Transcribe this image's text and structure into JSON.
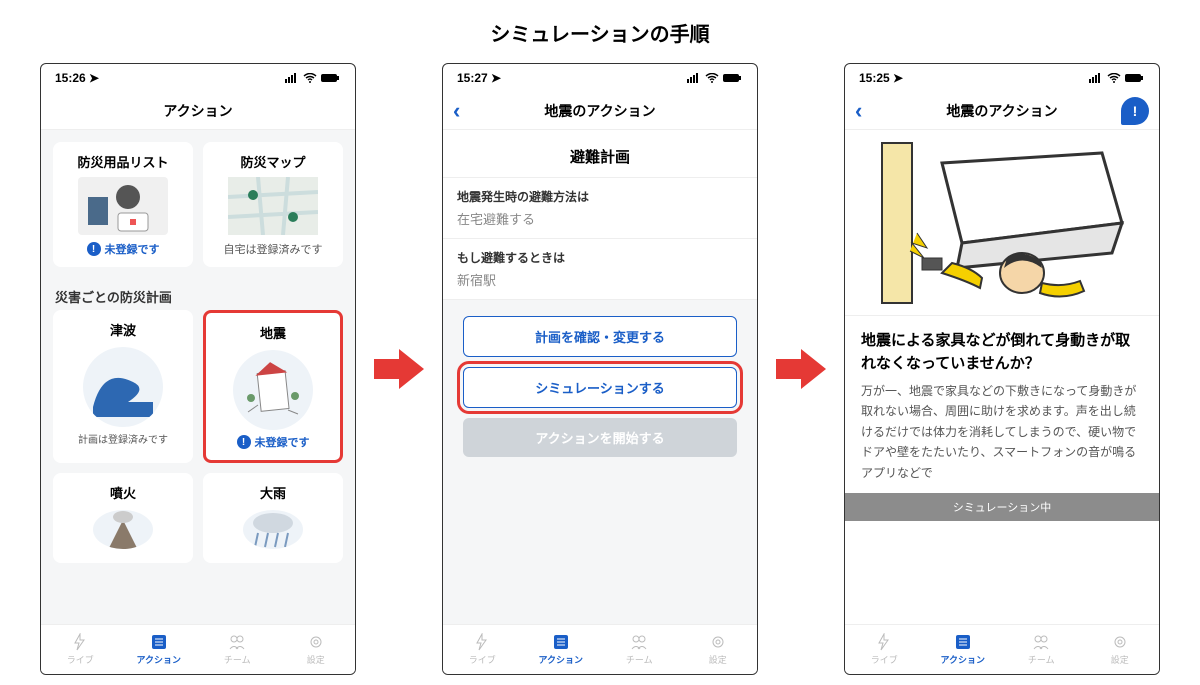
{
  "page_title": "シミュレーションの手順",
  "tabs": {
    "live": "ライブ",
    "action": "アクション",
    "team": "チーム",
    "settings": "設定"
  },
  "screen1": {
    "time": "15:26",
    "nav_title": "アクション",
    "card1_title": "防災用品リスト",
    "card1_status": "未登録です",
    "card2_title": "防災マップ",
    "card2_status": "自宅は登録済みです",
    "section_label": "災害ごとの防災計画",
    "hz_tsunami": "津波",
    "hz_tsunami_status": "計画は登録済みです",
    "hz_eq": "地震",
    "hz_eq_status": "未登録です",
    "hz_erupt": "噴火",
    "hz_rain": "大雨"
  },
  "screen2": {
    "time": "15:27",
    "nav_title": "地震のアクション",
    "subtitle": "避難計画",
    "row1_label": "地震発生時の避難方法は",
    "row1_value": "在宅避難する",
    "row2_label": "もし避難するときは",
    "row2_value": "新宿駅",
    "btn_confirm": "計画を確認・変更する",
    "btn_sim": "シミュレーションする",
    "btn_start": "アクションを開始する"
  },
  "screen3": {
    "time": "15:25",
    "nav_title": "地震のアクション",
    "question": "地震による家具などが倒れて身動きが取れなくなっていませんか？",
    "body": "万が一、地震で家具などの下敷きになって身動きが取れない場合、周囲に助けを求めます。声を出し続けるだけでは体力を消耗してしまうので、硬い物でドアや壁をたたいたり、スマートフォンの音が鳴るアプリなどで",
    "banner": "シミュレーション中"
  }
}
